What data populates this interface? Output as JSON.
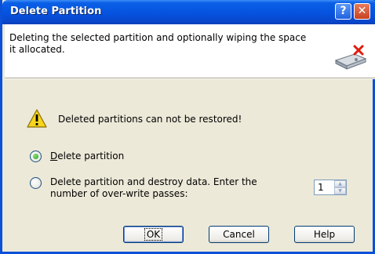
{
  "window": {
    "title": "Delete Partition",
    "help_glyph": "?",
    "close_glyph": "✕"
  },
  "header": {
    "description": "Deleting the selected partition and optionally wiping the space it allocated.",
    "icon": "hard-drive-delete-icon"
  },
  "warning": {
    "icon": "warning-icon",
    "text": "Deleted partitions can not be restored!"
  },
  "options": [
    {
      "label_prefix": "",
      "mnemonic": "D",
      "label_rest": "elete partition",
      "checked": true
    },
    {
      "label": "Delete partition and destroy data. Enter the number of over-write passes:",
      "checked": false
    }
  ],
  "passes": {
    "value": "1"
  },
  "buttons": {
    "ok": "OK",
    "cancel": "Cancel",
    "help": "Help"
  },
  "colors": {
    "titlebar": "#0653df",
    "dialog_bg": "#ece9d8",
    "radio_checked": "#21a121"
  }
}
